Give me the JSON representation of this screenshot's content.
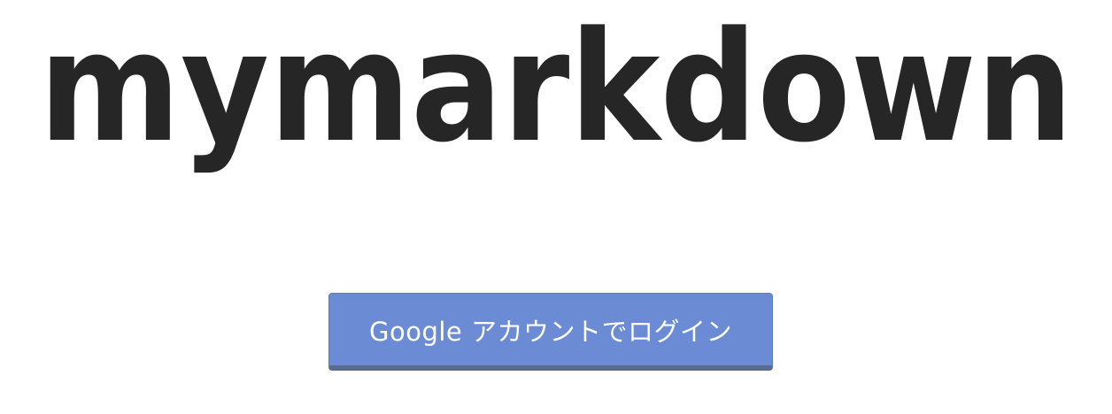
{
  "logo": {
    "text": "mymarkdown"
  },
  "login": {
    "label": "Google アカウントでログイン"
  },
  "colors": {
    "logo_text": "#262626",
    "button_bg": "#6b8bd4",
    "button_shadow": "#5b6b8f",
    "button_text": "#ffffff",
    "background": "#ffffff"
  }
}
